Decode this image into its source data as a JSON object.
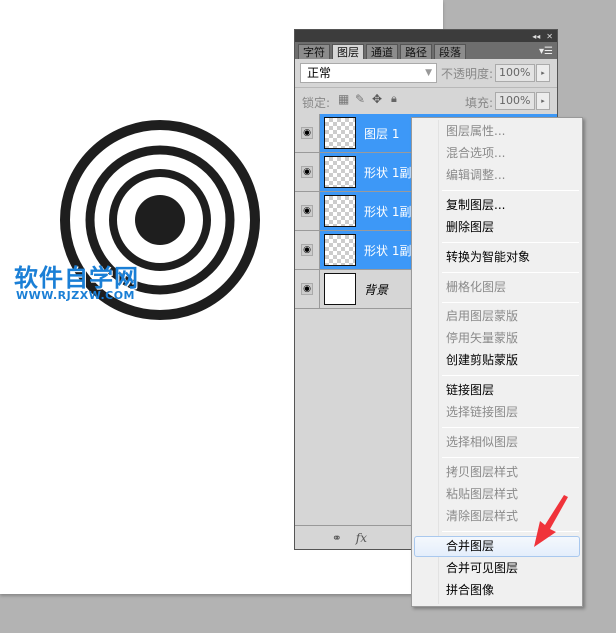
{
  "watermark": {
    "title": "软件自学网",
    "url": "WWW.RJZXW.COM"
  },
  "panel": {
    "tabs": [
      "字符",
      "图层",
      "通道",
      "路径",
      "段落"
    ],
    "active_tab": 1,
    "blend_mode": "正常",
    "opacity_label": "不透明度:",
    "opacity_value": "100%",
    "lock_label": "锁定:",
    "fill_label": "填充:",
    "fill_value": "100%",
    "layers": [
      {
        "name": "图层 1",
        "selected": true
      },
      {
        "name": "形状 1副",
        "selected": true
      },
      {
        "name": "形状 1副",
        "selected": true
      },
      {
        "name": "形状 1副",
        "selected": true
      },
      {
        "name": "背景",
        "selected": false
      }
    ],
    "bottom_icons": [
      "link-icon",
      "fx-icon"
    ],
    "fx_label": "fx"
  },
  "context_menu": {
    "groups": [
      [
        {
          "label": "图层属性...",
          "enabled": false
        },
        {
          "label": "混合选项...",
          "enabled": false
        },
        {
          "label": "编辑调整...",
          "enabled": false
        }
      ],
      [
        {
          "label": "复制图层...",
          "enabled": true
        },
        {
          "label": "删除图层",
          "enabled": true
        }
      ],
      [
        {
          "label": "转换为智能对象",
          "enabled": true
        }
      ],
      [
        {
          "label": "栅格化图层",
          "enabled": false
        }
      ],
      [
        {
          "label": "启用图层蒙版",
          "enabled": false
        },
        {
          "label": "停用矢量蒙版",
          "enabled": false
        },
        {
          "label": "创建剪贴蒙版",
          "enabled": true
        }
      ],
      [
        {
          "label": "链接图层",
          "enabled": true
        },
        {
          "label": "选择链接图层",
          "enabled": false
        }
      ],
      [
        {
          "label": "选择相似图层",
          "enabled": false
        }
      ],
      [
        {
          "label": "拷贝图层样式",
          "enabled": false
        },
        {
          "label": "粘贴图层样式",
          "enabled": false
        },
        {
          "label": "清除图层样式",
          "enabled": false
        }
      ],
      [
        {
          "label": "合并图层",
          "enabled": true,
          "highlighted": true
        },
        {
          "label": "合并可见图层",
          "enabled": true
        },
        {
          "label": "拼合图像",
          "enabled": true
        }
      ]
    ]
  },
  "colors": {
    "selection": "#3d98f7",
    "arrow": "#f0333a",
    "watermark": "#1a7fd6"
  }
}
